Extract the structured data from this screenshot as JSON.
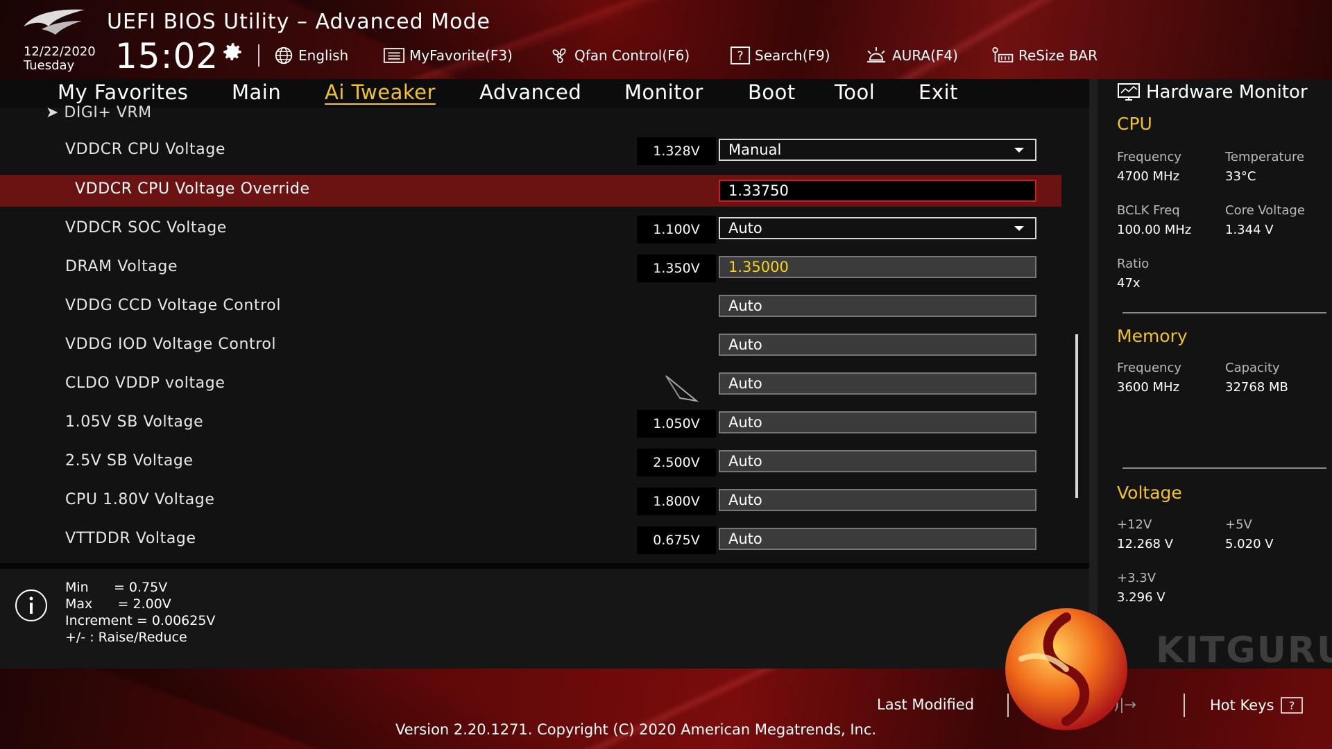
{
  "header": {
    "title": "UEFI BIOS Utility – Advanced Mode",
    "date": "12/22/2020",
    "day": "Tuesday",
    "time": "15:02",
    "tools": [
      {
        "label": "English",
        "icon": "globe-icon"
      },
      {
        "label": "MyFavorite(F3)",
        "icon": "favorite-list-icon"
      },
      {
        "label": "Qfan Control(F6)",
        "icon": "fan-icon"
      },
      {
        "label": "Search(F9)",
        "icon": "search-help-icon"
      },
      {
        "label": "AURA(F4)",
        "icon": "aura-light-icon"
      },
      {
        "label": "ReSize BAR",
        "icon": "resize-bar-icon"
      }
    ]
  },
  "nav": {
    "tabs": [
      {
        "label": "My Favorites"
      },
      {
        "label": "Main"
      },
      {
        "label": "Ai Tweaker"
      },
      {
        "label": "Advanced"
      },
      {
        "label": "Monitor"
      },
      {
        "label": "Boot"
      },
      {
        "label": "Tool"
      },
      {
        "label": "Exit"
      }
    ],
    "active": "Ai Tweaker"
  },
  "main": {
    "submenu": "➤ DIGI+ VRM",
    "rows": [
      {
        "label": "VDDCR CPU Voltage",
        "current": "1.328V",
        "setting": "Manual",
        "type": "dropdown"
      },
      {
        "label": "VDDCR CPU Voltage Override",
        "current": "",
        "setting": "1.33750",
        "type": "text"
      },
      {
        "label": "VDDCR SOC Voltage",
        "current": "1.100V",
        "setting": "Auto",
        "type": "dropdown"
      },
      {
        "label": "DRAM Voltage",
        "current": "1.350V",
        "setting": "1.35000",
        "type": "field"
      },
      {
        "label": "VDDG CCD Voltage Control",
        "current": "",
        "setting": "Auto",
        "type": "field"
      },
      {
        "label": "VDDG IOD Voltage Control",
        "current": "",
        "setting": "Auto",
        "type": "field"
      },
      {
        "label": "CLDO VDDP voltage",
        "current": "",
        "setting": "Auto",
        "type": "field"
      },
      {
        "label": "1.05V SB Voltage",
        "current": "1.050V",
        "setting": "Auto",
        "type": "field"
      },
      {
        "label": "2.5V SB Voltage",
        "current": "2.500V",
        "setting": "Auto",
        "type": "field"
      },
      {
        "label": "CPU 1.80V Voltage",
        "current": "1.800V",
        "setting": "Auto",
        "type": "field"
      },
      {
        "label": "VTTDDR Voltage",
        "current": "0.675V",
        "setting": "Auto",
        "type": "field"
      }
    ]
  },
  "info": {
    "lines": [
      "Min      = 0.75V",
      "Max      = 2.00V",
      "Increment = 0.00625V",
      "+/- : Raise/Reduce"
    ]
  },
  "hw": {
    "title": "Hardware Monitor",
    "cpu": {
      "heading": "CPU",
      "frequency_label": "Frequency",
      "frequency": "4700 MHz",
      "temperature_label": "Temperature",
      "temperature": "33°C",
      "bclk_label": "BCLK Freq",
      "bclk": "100.00 MHz",
      "core_voltage_label": "Core Voltage",
      "core_voltage": "1.344 V",
      "ratio_label": "Ratio",
      "ratio": "47x"
    },
    "memory": {
      "heading": "Memory",
      "frequency_label": "Frequency",
      "frequency": "3600 MHz",
      "capacity_label": "Capacity",
      "capacity": "32768 MB"
    },
    "voltage": {
      "heading": "Voltage",
      "v12_label": "+12V",
      "v12": "12.268 V",
      "v5_label": "+5V",
      "v5": "5.020 V",
      "v33_label": "+3.3V",
      "v33": "3.296 V"
    }
  },
  "footer": {
    "last_modified": "Last Modified",
    "ezmode": "EzMode(F7)|→",
    "hotkeys": "Hot Keys",
    "copyright": "Version 2.20.1271. Copyright (C) 2020 American Megatrends, Inc.",
    "watermark": "KITGURU"
  },
  "colors": {
    "accent": "#f2c421",
    "selected_row": "#6b1212",
    "override_border": "#c62020"
  }
}
